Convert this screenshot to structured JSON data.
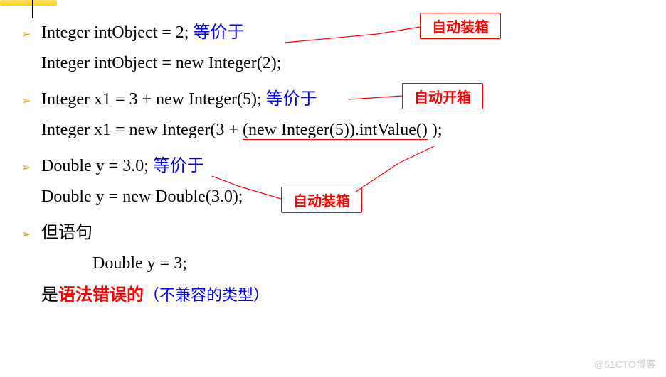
{
  "highlight": true,
  "lines": {
    "l1_code": "Integer  intObject  = 2;",
    "l1_eq": " 等价于",
    "l2_code": "Integer  intObject = new  Integer(2);",
    "l3_code": "Integer x1 = 3 + new Integer(5);",
    "l3_eq": " 等价于",
    "l4_code_a": "Integer x1 = new Integer(3 + ",
    "l4_code_b": "(new Integer(5)).intValue()",
    "l4_code_c": " );",
    "l5_code": "Double  y = 3.0;",
    "l5_eq": " 等价于",
    "l6_code": "Double  y =  new Double(3.0);",
    "l7_code": "但语句",
    "l8_code": "Double  y = 3;",
    "l9_a": "是",
    "l9_b": "语法错误的",
    "l9_c": "（不兼容的类型）"
  },
  "callouts": {
    "box1": "自动装箱",
    "box2": "自动开箱",
    "box3": "自动装箱"
  },
  "watermark": "@51CTO博客"
}
